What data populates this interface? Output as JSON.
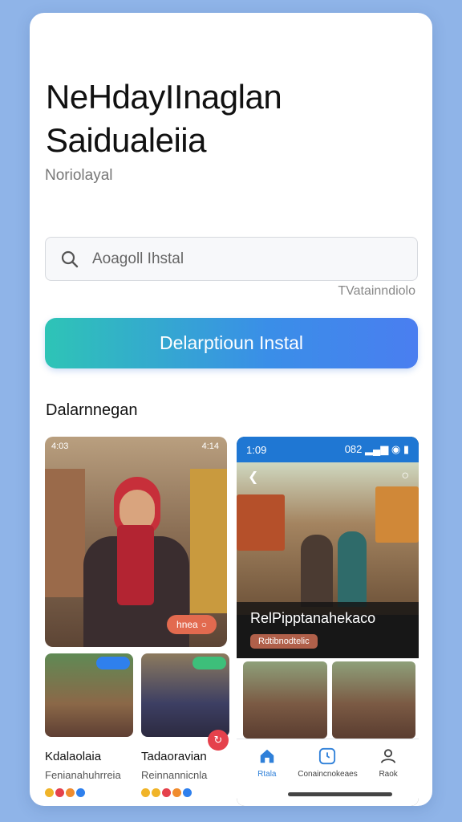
{
  "header": {
    "title_line1": "NeHdayIInaglan",
    "title_line2": "Saidualeiia",
    "subtitle": "Noriolayal"
  },
  "search": {
    "placeholder": "Aoagoll Ihstal",
    "hint": "TVatainndiolo"
  },
  "cta": {
    "label": "Delarptioun Instal"
  },
  "section": {
    "title": "Dalarnnegan"
  },
  "featured": {
    "chip_label": "hnea",
    "status_left": "4:03",
    "status_right": "4:14"
  },
  "phone": {
    "time": "1:09",
    "status_right": "082",
    "overlay_title": "RelPipptanahekaco",
    "overlay_chip": "Rdtibnodtelic",
    "nav": [
      {
        "label": "Rtala",
        "icon": "home-icon"
      },
      {
        "label": "Conaincnokeaes",
        "icon": "clock-icon"
      },
      {
        "label": "Raok",
        "icon": "person-icon"
      }
    ]
  },
  "cards": [
    {
      "title": "Kdalaolaia",
      "subtitle": "Fenianahuhrreia"
    },
    {
      "title": "Tadaoravian",
      "subtitle": "Reinnannicnla"
    }
  ],
  "colors": {
    "accent_start": "#2ec4b6",
    "accent_end": "#4a7ef0",
    "background": "#8fb4e8",
    "phone_status_bar": "#1f77d3"
  }
}
